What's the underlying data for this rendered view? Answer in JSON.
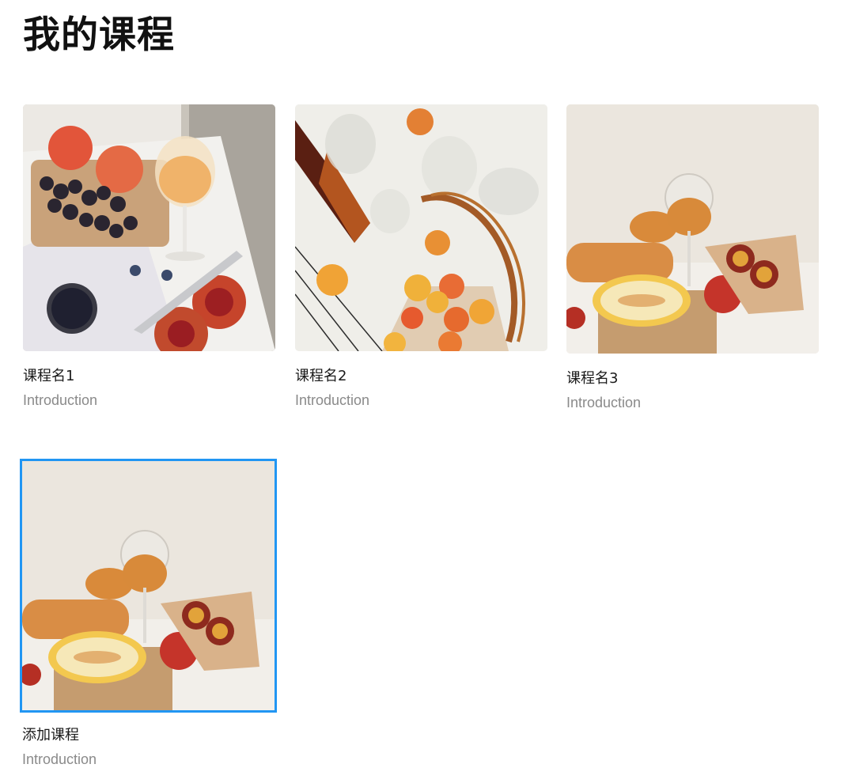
{
  "page": {
    "title": "我的课程"
  },
  "courses": [
    {
      "title": "课程名1",
      "subtitle": "Introduction",
      "image": "picnic-peaches-grapes-wine-photo"
    },
    {
      "title": "课程名2",
      "subtitle": "Introduction",
      "image": "apricots-net-bag-bottle-photo"
    },
    {
      "title": "课程名3",
      "subtitle": "Introduction",
      "image": "melon-bread-wine-still-life-photo"
    }
  ],
  "add_course": {
    "title": "添加课程",
    "subtitle": "Introduction",
    "image": "melon-bread-wine-still-life-photo"
  },
  "colors": {
    "selection_border": "#2196f3",
    "subtitle_text": "#8a8a8a"
  }
}
